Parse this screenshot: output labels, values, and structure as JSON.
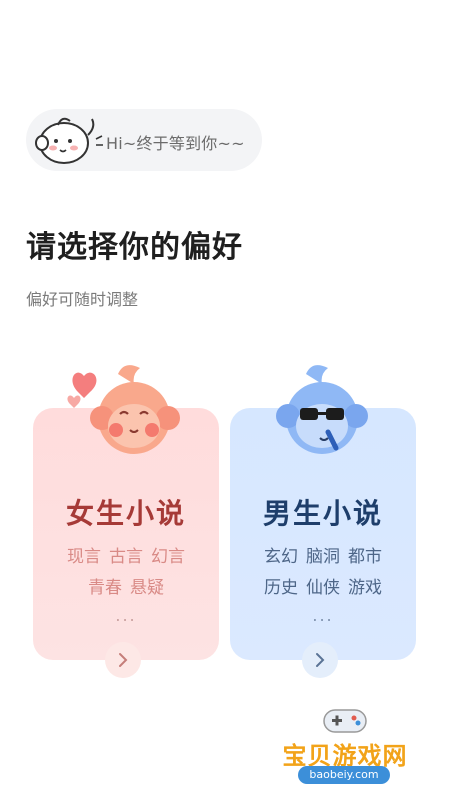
{
  "greeting": {
    "text": "Hi~终于等到你~~",
    "icon": "monkey-waving-icon"
  },
  "header": {
    "title": "请选择你的偏好",
    "subtitle": "偏好可随时调整"
  },
  "cards": {
    "female": {
      "title": "女生小说",
      "tags_row1": [
        "现言",
        "古言",
        "幻言"
      ],
      "tags_row2": [
        "青春",
        "悬疑"
      ],
      "more": "...",
      "color": "#a63a37",
      "icon": "monkey-heart-icon"
    },
    "male": {
      "title": "男生小说",
      "tags_row1": [
        "玄幻",
        "脑洞",
        "都市"
      ],
      "tags_row2": [
        "历史",
        "仙侠",
        "游戏"
      ],
      "more": "...",
      "color": "#1e3e6b",
      "icon": "monkey-sunglasses-icon"
    }
  },
  "watermark": {
    "name": "宝贝游戏网",
    "url": "baobeiy.com"
  }
}
